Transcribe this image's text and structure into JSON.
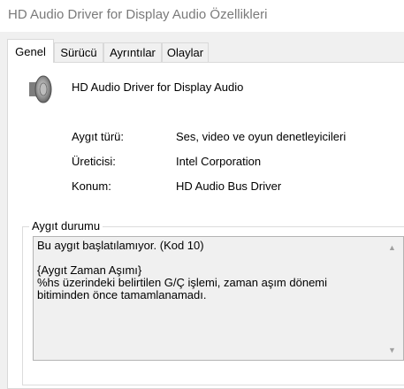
{
  "window": {
    "title": "HD Audio Driver for Display Audio Özellikleri"
  },
  "tabs": [
    {
      "label": "Genel",
      "active": true
    },
    {
      "label": "Sürücü",
      "active": false
    },
    {
      "label": "Ayrıntılar",
      "active": false
    },
    {
      "label": "Olaylar",
      "active": false
    }
  ],
  "device": {
    "name": "HD Audio Driver for Display Audio",
    "icon": "speaker-icon"
  },
  "properties": [
    {
      "label": "Aygıt türü:",
      "value": "Ses, video ve oyun denetleyicileri"
    },
    {
      "label": "Üreticisi:",
      "value": "Intel Corporation"
    },
    {
      "label": "Konum:",
      "value": "HD Audio Bus Driver"
    }
  ],
  "status": {
    "group_title": "Aygıt durumu",
    "text": "Bu aygıt başlatılamıyor. (Kod 10)\n\n{Aygıt Zaman Aşımı}\n%hs üzerindeki belirtilen G/Ç işlemi, zaman aşım dönemi\nbitiminden önce tamamlanamadı."
  },
  "colors": {
    "title_text": "#7a7a7a",
    "panel_bg": "#ffffff",
    "window_bg": "#f0f0f0"
  }
}
